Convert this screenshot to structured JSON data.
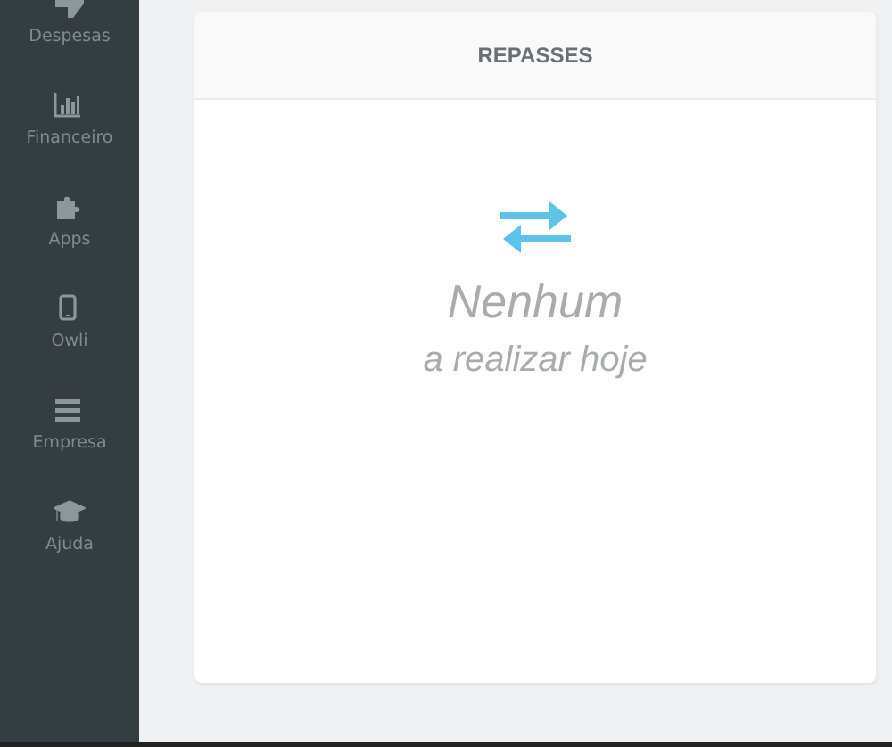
{
  "sidebar": {
    "items": [
      {
        "label": "Despesas",
        "kind": "thumb"
      },
      {
        "label": "Financeiro",
        "kind": "chart"
      },
      {
        "label": "Apps",
        "kind": "puzzle"
      },
      {
        "label": "Owli",
        "kind": "phone"
      },
      {
        "label": "Empresa",
        "kind": "bars"
      },
      {
        "label": "Ajuda",
        "kind": "cap"
      }
    ]
  },
  "card": {
    "title": "REPASSES",
    "empty_title": "Nenhum",
    "empty_subtitle": "a realizar hoje"
  }
}
